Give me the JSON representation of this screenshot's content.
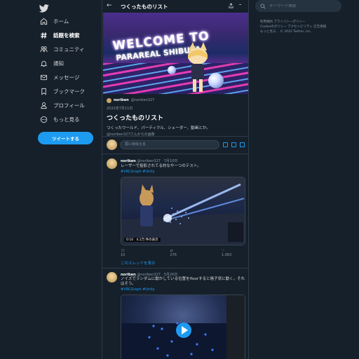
{
  "nav": {
    "items": [
      {
        "label": "ホーム",
        "icon": "home-icon"
      },
      {
        "label": "話題を検索",
        "icon": "hashtag-icon"
      },
      {
        "label": "コミュニティ",
        "icon": "communities-icon"
      },
      {
        "label": "通知",
        "icon": "bell-icon"
      },
      {
        "label": "メッセージ",
        "icon": "mail-icon"
      },
      {
        "label": "ブックマーク",
        "icon": "bookmark-icon"
      },
      {
        "label": "プロフィール",
        "icon": "profile-icon"
      },
      {
        "label": "もっと見る",
        "icon": "more-circle-icon"
      }
    ],
    "tweet_button": "ツイートする"
  },
  "header": {
    "title": "つくったものリスト"
  },
  "banner": {
    "sign_line1": "WELCOME TO",
    "sign_line2": "PARAREAL SHIBUYA"
  },
  "list": {
    "owner_name": "noriben",
    "owner_handle": "@noriben327",
    "date": "2022年7月11日",
    "title": "つくったものリスト",
    "description": "つくったワールド、パーティクル、シェーダー、動画とか。",
    "created_by": "@noriben327さんからの画像"
  },
  "compose": {
    "placeholder": "思い出伝える"
  },
  "tweets": [
    {
      "name": "noriben",
      "handle": "@noriben327 · 7月10日",
      "text": "レーザーで投影されてる的なや一つのテスト。",
      "tags": "#VRCGraph #Unity",
      "video_time": "0:10",
      "video_views": "4.2万 件の表示",
      "replies": "10",
      "retweets": "276",
      "likes": "1,063",
      "thread_link": "このスレッドを表示"
    },
    {
      "name": "noriben",
      "handle": "@noriben327 · 5月26日",
      "text": "ノイズでランダムに動かしている位置をfloorすると格子状に動く。それはそう。",
      "tags": "#VRCGraph #Unity"
    }
  ],
  "search": {
    "placeholder": "キーワード検索"
  },
  "footer": {
    "line1": "利用規約  プライバシーポリシー",
    "line2": "Cookieのポリシー  アクセシビリティ  広告情報",
    "line3": "もっと見る…  © 2022 Twitter, Inc."
  },
  "colors": {
    "background": "#15202b",
    "accent": "#1d9bf0",
    "muted": "#8899a6",
    "border": "#2f3b47"
  }
}
